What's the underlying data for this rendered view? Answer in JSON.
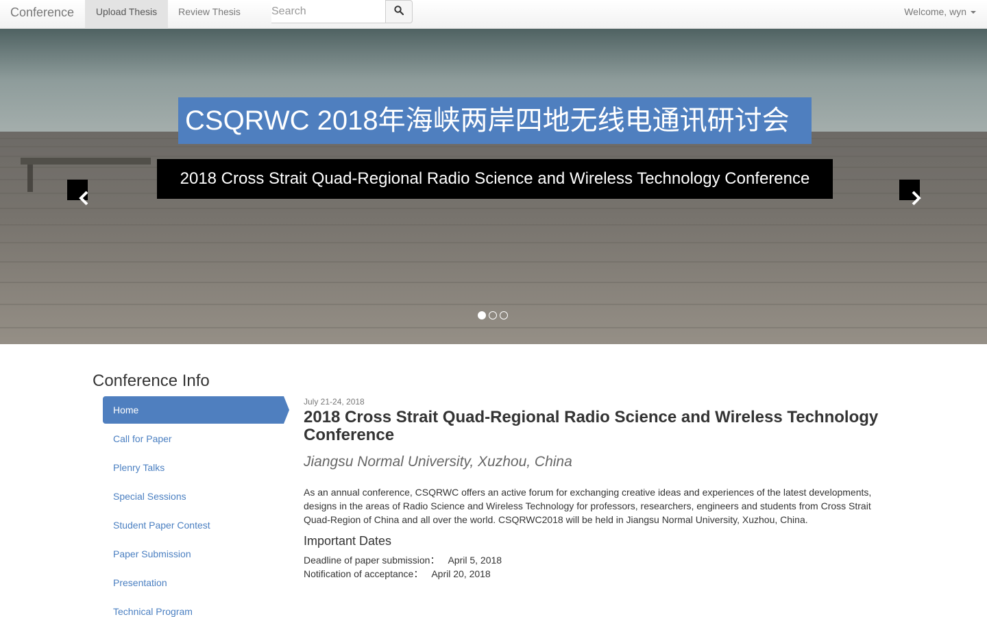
{
  "navbar": {
    "brand": "Conference",
    "items": [
      {
        "label": "Upload Thesis",
        "active": true
      },
      {
        "label": "Review Thesis",
        "active": false
      }
    ],
    "search_placeholder": "Search",
    "search_icon": "search-icon",
    "user_menu_label": "Welcome, wyn"
  },
  "hero": {
    "title_cn": "CSQRWC   2018年海峡两岸四地无线电通讯研讨会",
    "title_en": "2018 Cross Strait Quad-Regional Radio Science and Wireless Technology Conference",
    "slide_count": 3,
    "active_slide": 1,
    "prev_icon": "chevron-left-icon",
    "next_icon": "chevron-right-icon"
  },
  "sidebar": {
    "title": "Conference Info",
    "items": [
      {
        "label": "Home",
        "active": true
      },
      {
        "label": "Call for Paper",
        "active": false
      },
      {
        "label": "Plenry Talks",
        "active": false
      },
      {
        "label": "Special Sessions",
        "active": false
      },
      {
        "label": "Student Paper Contest",
        "active": false
      },
      {
        "label": "Paper Submission",
        "active": false
      },
      {
        "label": "Presentation",
        "active": false
      },
      {
        "label": "Technical Program",
        "active": false
      }
    ]
  },
  "main": {
    "date": "July 21-24, 2018",
    "title": "2018 Cross Strait Quad-Regional Radio Science and Wireless Technology Conference",
    "venue": "Jiangsu Normal University, Xuzhou, China",
    "description": "As an annual conference, CSQRWC offers an active forum for exchanging creative ideas and experiences of the latest developments, designs in the areas of Radio Science and Wireless Technology for professors, researchers, engineers and students from Cross Strait Quad-Region of China and all over the world. CSQRWC2018 will be held in Jiangsu Normal University, Xuzhou, China.",
    "important_dates_heading": "Important Dates",
    "important_dates": [
      {
        "label": "Deadline of paper submission：",
        "value": "April 5, 2018"
      },
      {
        "label": "Notification of acceptance：",
        "value": "April 20, 2018"
      }
    ]
  },
  "colors": {
    "accent": "#4f7fbf",
    "link": "#4a7fc1",
    "caption_bg": "#000000"
  }
}
